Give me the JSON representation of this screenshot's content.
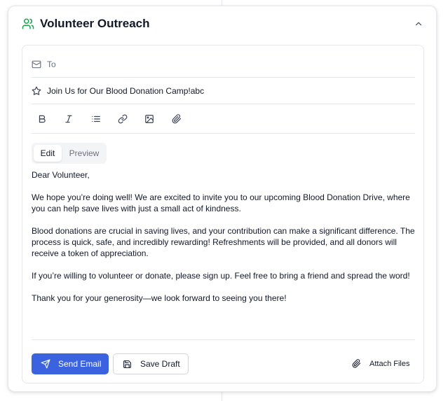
{
  "header": {
    "title": "Volunteer Outreach",
    "icon": "users-icon",
    "collapse_icon": "chevron-up-icon"
  },
  "compose": {
    "to": {
      "placeholder": "To",
      "value": ""
    },
    "subject": {
      "value": "Join Us for Our Blood Donation Camp!abc"
    },
    "toolbar": [
      "bold-icon",
      "italic-icon",
      "list-icon",
      "link-icon",
      "image-icon",
      "paperclip-icon"
    ],
    "tabs": {
      "edit": "Edit",
      "preview": "Preview",
      "active": "Edit"
    },
    "body": [
      "Dear Volunteer,",
      "We hope you’re doing well! We are excited to invite you to our upcoming Blood Donation Drive, where you can help save lives with just a small act of kindness.",
      "Blood donations are crucial in saving lives, and your contribution can make a significant difference. The process is quick, safe, and incredibly rewarding! Refreshments will be provided, and all donors will receive a token of appreciation.",
      "If you’re willing to volunteer or donate, please sign up. Feel free to bring a friend and spread the word!",
      "Thank you for your generosity—we look forward to seeing you there!"
    ]
  },
  "actions": {
    "send_label": "Send Email",
    "draft_label": "Save Draft",
    "attach_label": "Attach Files"
  },
  "colors": {
    "accent": "#3b63e0",
    "header_icon": "#16a34a",
    "border": "#e5e7eb"
  }
}
